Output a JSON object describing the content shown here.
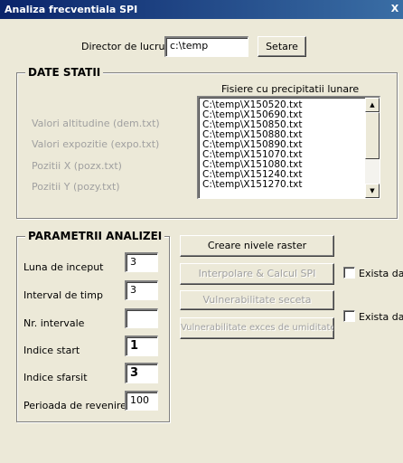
{
  "window": {
    "title": "Analiza frecventiala SPI",
    "close_glyph": "X"
  },
  "workdir": {
    "label": "Director de lucru",
    "value": "c:\\temp",
    "set_button": "Setare"
  },
  "date_statii": {
    "title": "DATE STATII",
    "list_header": "Fisiere cu precipitatii lunare",
    "labels": [
      "Valori altitudine (dem.txt)",
      "Valori expozitie (expo.txt)",
      "Pozitii X (pozx.txt)",
      "Pozitii Y (pozy.txt)"
    ],
    "files": [
      "C:\\temp\\X150520.txt",
      "C:\\temp\\X150690.txt",
      "C:\\temp\\X150850.txt",
      "C:\\temp\\X150880.txt",
      "C:\\temp\\X150890.txt",
      "C:\\temp\\X151070.txt",
      "C:\\temp\\X151080.txt",
      "C:\\temp\\X151240.txt",
      "C:\\temp\\X151270.txt"
    ]
  },
  "parametrii": {
    "title": "PARAMETRII ANALIZEI",
    "fields": [
      {
        "label": "Luna de inceput",
        "value": "3"
      },
      {
        "label": "Interval de timp",
        "value": "3"
      },
      {
        "label": "Nr. intervale",
        "value": ""
      },
      {
        "label": "Indice start",
        "value": "1"
      },
      {
        "label": "Indice sfarsit",
        "value": "3"
      },
      {
        "label": "Perioada de revenire",
        "value": "100"
      }
    ]
  },
  "actions": {
    "creare": "Creare nivele raster",
    "interpolare": "Interpolare & Calcul SPI",
    "vulnerabilitate_seceta": "Vulnerabilitate seceta",
    "vulnerabilitate_exces": "Vulnerabilitate exces de umiditate",
    "exista_date_1": "Exista date",
    "exista_date_2": "Exista date"
  }
}
